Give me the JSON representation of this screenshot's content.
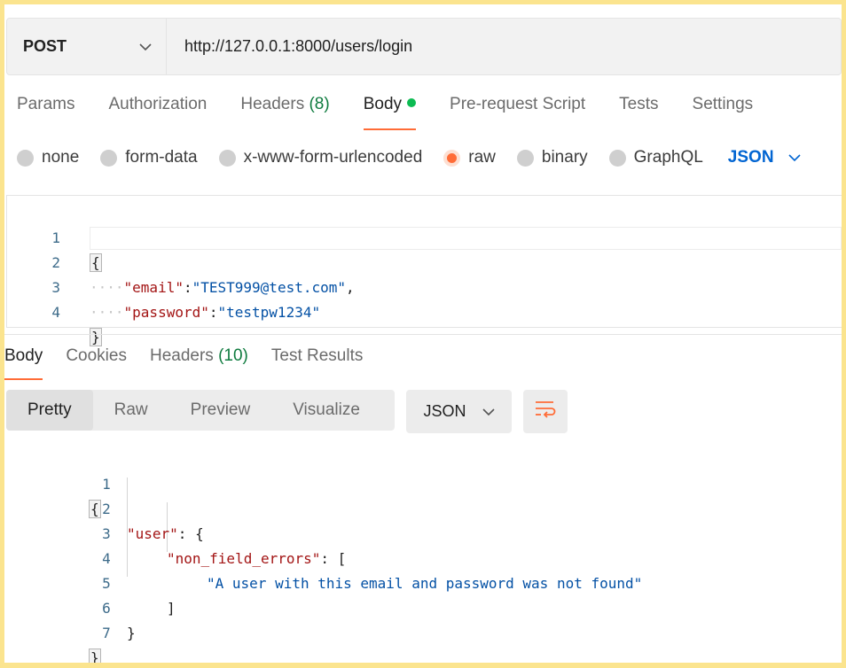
{
  "request": {
    "method": "POST",
    "url": "http://127.0.0.1:8000/users/login"
  },
  "request_tabs": [
    {
      "label": "Params"
    },
    {
      "label": "Authorization"
    },
    {
      "label": "Headers",
      "count": "(8)"
    },
    {
      "label": "Body",
      "active": true,
      "indicator": "green-dot"
    },
    {
      "label": "Pre-request Script"
    },
    {
      "label": "Tests"
    },
    {
      "label": "Settings"
    }
  ],
  "body_types": [
    {
      "label": "none"
    },
    {
      "label": "form-data"
    },
    {
      "label": "x-www-form-urlencoded"
    },
    {
      "label": "raw",
      "selected": true
    },
    {
      "label": "binary"
    },
    {
      "label": "GraphQL"
    }
  ],
  "body_language": "JSON",
  "request_body": {
    "line_numbers": [
      "1",
      "2",
      "3",
      "4"
    ],
    "open_brace": "{",
    "close_brace": "}",
    "email_key": "\"email\"",
    "email_value": "\"TEST999@test.com\"",
    "password_key": "\"password\"",
    "password_value": "\"testpw1234\"",
    "indent_dots": "····",
    "colon": ":",
    "comma": ","
  },
  "response_tabs": [
    {
      "label": "Body",
      "active": true
    },
    {
      "label": "Cookies"
    },
    {
      "label": "Headers",
      "count": "(10)"
    },
    {
      "label": "Test Results"
    }
  ],
  "view_modes": [
    {
      "label": "Pretty",
      "active": true
    },
    {
      "label": "Raw"
    },
    {
      "label": "Preview"
    },
    {
      "label": "Visualize"
    }
  ],
  "response_format": "JSON",
  "response_body": {
    "line_numbers": [
      "1",
      "2",
      "3",
      "4",
      "5",
      "6",
      "7"
    ],
    "open_brace": "{",
    "user_key": "\"user\"",
    "user_sep": ": {",
    "errors_key": "\"non_field_errors\"",
    "errors_sep": ": [",
    "message": "\"A user with this email and password was not found\"",
    "close_bracket": "]",
    "inner_close": "}",
    "close_brace": "}"
  },
  "colors": {
    "accent": "#ff6c37",
    "active_dot": "#0cbb52",
    "link_blue": "#0265d2",
    "count_green": "#0f7b3f",
    "frame_border": "#fbe48e"
  },
  "icons": {
    "method_dropdown": "chevron-down-icon",
    "language_dropdown": "chevron-down-icon",
    "format_dropdown": "chevron-down-icon",
    "wrap": "wrap-lines-icon"
  }
}
